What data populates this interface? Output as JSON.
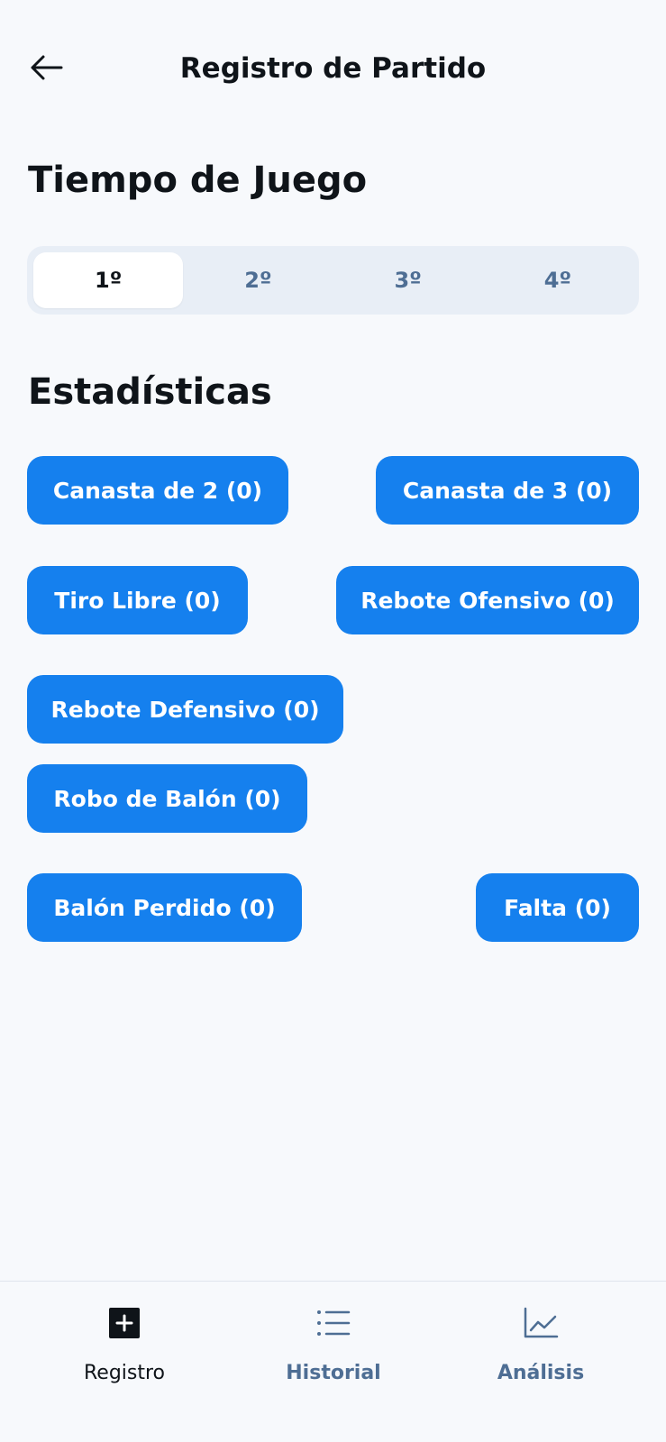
{
  "header": {
    "title": "Registro de Partido",
    "back_icon": "arrow-left-icon"
  },
  "game_time": {
    "title": "Tiempo de Juego",
    "periods": [
      {
        "label": "1º",
        "selected": true
      },
      {
        "label": "2º",
        "selected": false
      },
      {
        "label": "3º",
        "selected": false
      },
      {
        "label": "4º",
        "selected": false
      }
    ]
  },
  "stats": {
    "title": "Estadísticas",
    "buttons": [
      {
        "label": "Canasta de 2 (0)"
      },
      {
        "label": "Canasta de 3 (0)"
      },
      {
        "label": "Tiro Libre (0)"
      },
      {
        "label": "Rebote Ofensivo (0)"
      },
      {
        "label": "Rebote Defensivo (0)"
      },
      {
        "label": "Robo de Balón (0)"
      },
      {
        "label": "Balón Perdido (0)"
      },
      {
        "label": "Falta (0)"
      }
    ]
  },
  "bottom_nav": {
    "items": [
      {
        "label": "Registro",
        "icon": "plus-square-icon",
        "active": true
      },
      {
        "label": "Historial",
        "icon": "list-icon",
        "active": false
      },
      {
        "label": "Análisis",
        "icon": "line-chart-icon",
        "active": false
      }
    ]
  },
  "colors": {
    "accent": "#1580ee",
    "background": "#f7f9fc",
    "segment_bg": "#e8eef6",
    "inactive_text": "#4e6e94",
    "text": "#0f1419"
  }
}
